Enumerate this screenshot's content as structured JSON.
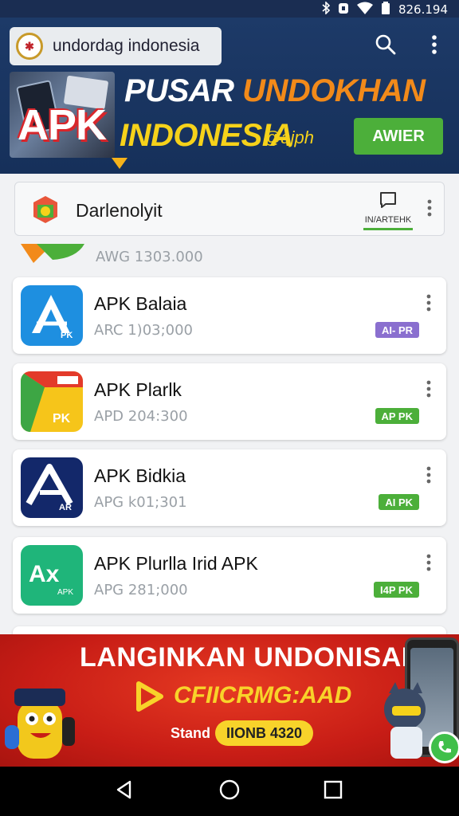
{
  "status_bar": {
    "time": "826.194"
  },
  "header": {
    "search_text": "undordag indonesia",
    "banner": {
      "apk_label": "APK",
      "title_word1": "PUSAR",
      "title_word2": "UNDOKHAN",
      "title_line2": "INDONESIA",
      "sub": "@ajph",
      "cta_label": "AWIER"
    }
  },
  "section": {
    "title": "Darlenolyit",
    "chat_label": "IN/ARTEHK"
  },
  "partial_item": {
    "size": "AWG 1303.000"
  },
  "apps": [
    {
      "name": "APK Balaia",
      "size": "ARC 1)03;000",
      "badge": "AI- PR",
      "badge_color": "#8a6fcf"
    },
    {
      "name": "APK Plarlk",
      "size": "APD 204:300",
      "badge": "AP PK",
      "badge_color": "#4caf3a"
    },
    {
      "name": "APK Bidkia",
      "size": "APG k01;301",
      "badge": "AI PK",
      "badge_color": "#4caf3a"
    },
    {
      "name": "APK Plurlla Irid APK",
      "size": "APG 281;000",
      "badge": "I4P PK",
      "badge_color": "#4caf3a"
    }
  ],
  "ad": {
    "title": "LANGINKAN UNDONISAN",
    "sub": "CFIICRMG:AAD",
    "small": "Stand",
    "pill": "IIONB 4320"
  },
  "colors": {
    "header_bg": "#1d3a68",
    "accent_green": "#4caf3a",
    "ad_red": "#d8261b",
    "ad_yellow": "#f8d32a",
    "title_orange": "#f28a1a",
    "title_yellow": "#f6d21a"
  },
  "icons": {
    "status": [
      "bluetooth-icon",
      "alarm-icon",
      "wifi-icon",
      "battery-icon"
    ],
    "header": [
      "search-icon",
      "more-vert-icon"
    ],
    "nav": [
      "back-icon",
      "home-icon",
      "recents-icon"
    ]
  }
}
